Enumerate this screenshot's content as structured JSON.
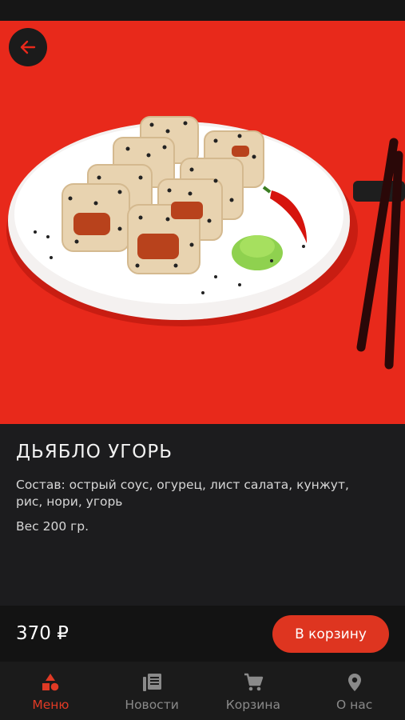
{
  "product": {
    "title": "ДЬЯБЛО УГОРЬ",
    "composition": "Состав: острый соус, огурец, лист салата, кунжут, рис, нори, угорь",
    "weight": "Вес 200 гр.",
    "price": "370 ₽",
    "image_icon": "sushi-roll-plate-photo"
  },
  "actions": {
    "back_icon": "arrow-left-icon",
    "add_to_cart": "В корзину"
  },
  "nav": {
    "items": [
      {
        "label": "Меню",
        "icon": "shapes-icon",
        "active": true
      },
      {
        "label": "Новости",
        "icon": "newspaper-icon",
        "active": false
      },
      {
        "label": "Корзина",
        "icon": "cart-icon",
        "active": false
      },
      {
        "label": "О нас",
        "icon": "location-pin-icon",
        "active": false
      }
    ]
  },
  "colors": {
    "accent": "#de3520",
    "hero_background": "#e8291b",
    "background": "#1c1c1e"
  }
}
